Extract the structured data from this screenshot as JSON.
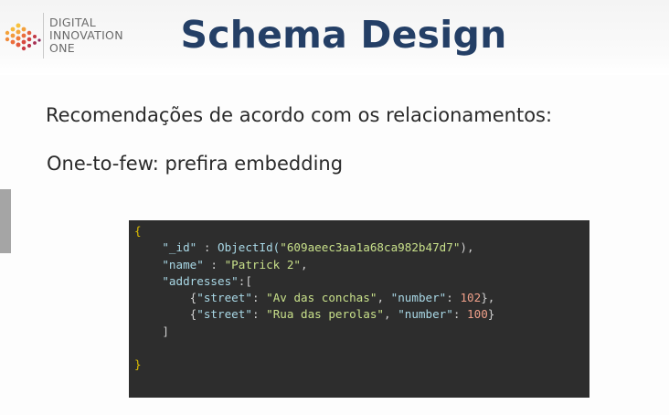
{
  "brand": {
    "line1": "DIGITAL",
    "line2": "INNOVATION",
    "line3": "ONE"
  },
  "title": "Schema Design",
  "subtitle": "Recomendações de acordo com os relacionamentos:",
  "rule": "One-to-few: prefira embedding",
  "code": {
    "open_brace": "{",
    "id_key": "\"_id\"",
    "id_sep": " : ",
    "id_fn": "ObjectId(",
    "id_value": "\"609aeec3aa1a68ca982b47d7\"",
    "id_end": "),",
    "name_key": "\"name\"",
    "name_sep": " : ",
    "name_value": "\"Patrick 2\"",
    "name_end": ",",
    "addr_key": "\"addresses\"",
    "addr_open": ":[",
    "addr1": {
      "street_key": "\"street\"",
      "street_value": "\"Av das conchas\"",
      "number_key": "\"number\"",
      "number_value": "102",
      "end": "},"
    },
    "addr2": {
      "street_key": "\"street\"",
      "street_value": "\"Rua das perolas\"",
      "number_key": "\"number\"",
      "number_value": "100",
      "end": "}"
    },
    "addr_close": "]",
    "close_brace": "}"
  },
  "colors": {
    "title": "#243f66",
    "code_bg": "#2d2d2d",
    "brace": "#e0c000",
    "key": "#a9d8e6",
    "string": "#c8e08a",
    "number": "#f0a08a"
  }
}
